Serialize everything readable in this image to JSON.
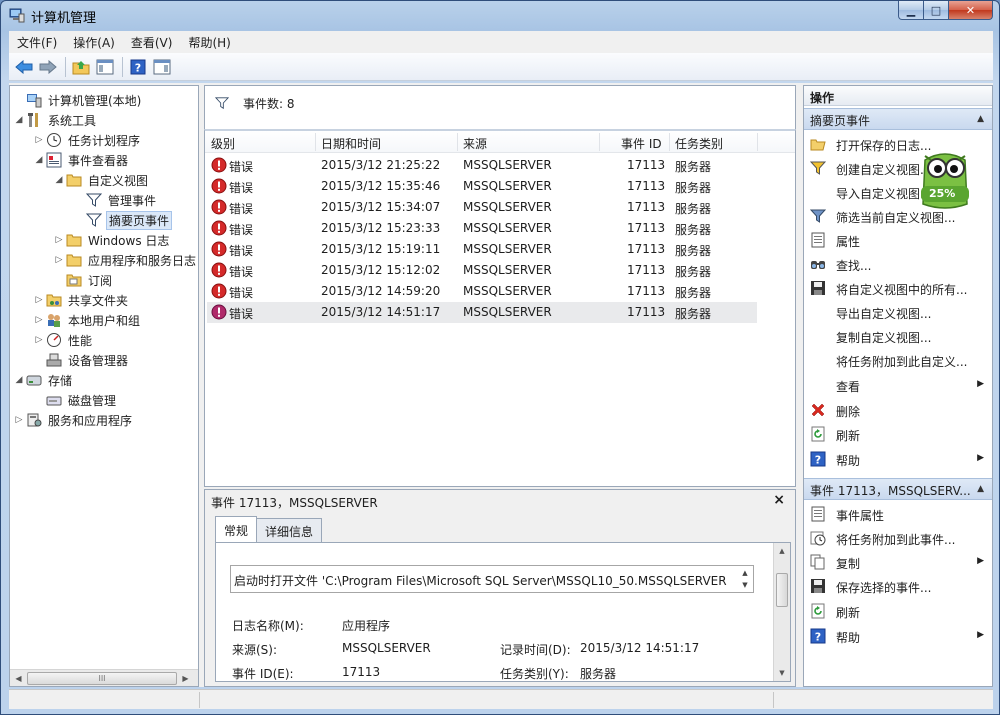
{
  "window": {
    "title": "计算机管理",
    "buttons": {
      "minimize": "▁",
      "maximize": "□",
      "close": "✕"
    }
  },
  "menu": [
    "文件(F)",
    "操作(A)",
    "查看(V)",
    "帮助(H)"
  ],
  "tree": {
    "items": [
      {
        "label": "计算机管理(本地)",
        "icon": "computer-icon"
      },
      {
        "label": "系统工具",
        "icon": "tools-icon"
      },
      {
        "label": "任务计划程序",
        "icon": "clock-icon"
      },
      {
        "label": "事件查看器",
        "icon": "event-viewer-icon"
      },
      {
        "label": "自定义视图",
        "icon": "folder-icon"
      },
      {
        "label": "管理事件",
        "icon": "filter-icon"
      },
      {
        "label": "摘要页事件",
        "icon": "filter-icon"
      },
      {
        "label": "Windows 日志",
        "icon": "folder-icon"
      },
      {
        "label": "应用程序和服务日志",
        "icon": "folder-icon"
      },
      {
        "label": "订阅",
        "icon": "subscription-icon"
      },
      {
        "label": "共享文件夹",
        "icon": "shared-folder-icon"
      },
      {
        "label": "本地用户和组",
        "icon": "users-icon"
      },
      {
        "label": "性能",
        "icon": "performance-icon"
      },
      {
        "label": "设备管理器",
        "icon": "device-manager-icon"
      },
      {
        "label": "存储",
        "icon": "storage-icon"
      },
      {
        "label": "磁盘管理",
        "icon": "disk-icon"
      },
      {
        "label": "服务和应用程序",
        "icon": "services-icon"
      }
    ],
    "scroll_grip": "III"
  },
  "events": {
    "count_label": "事件数: 8",
    "columns": [
      "级别",
      "日期和时间",
      "来源",
      "事件 ID",
      "任务类别"
    ],
    "rows": [
      {
        "level": "错误",
        "datetime": "2015/3/12 21:25:22",
        "source": "MSSQLSERVER",
        "event_id": "17113",
        "category": "服务器"
      },
      {
        "level": "错误",
        "datetime": "2015/3/12 15:35:46",
        "source": "MSSQLSERVER",
        "event_id": "17113",
        "category": "服务器"
      },
      {
        "level": "错误",
        "datetime": "2015/3/12 15:34:07",
        "source": "MSSQLSERVER",
        "event_id": "17113",
        "category": "服务器"
      },
      {
        "level": "错误",
        "datetime": "2015/3/12 15:23:33",
        "source": "MSSQLSERVER",
        "event_id": "17113",
        "category": "服务器"
      },
      {
        "level": "错误",
        "datetime": "2015/3/12 15:19:11",
        "source": "MSSQLSERVER",
        "event_id": "17113",
        "category": "服务器"
      },
      {
        "level": "错误",
        "datetime": "2015/3/12 15:12:02",
        "source": "MSSQLSERVER",
        "event_id": "17113",
        "category": "服务器"
      },
      {
        "level": "错误",
        "datetime": "2015/3/12 14:59:20",
        "source": "MSSQLSERVER",
        "event_id": "17113",
        "category": "服务器"
      },
      {
        "level": "错误",
        "datetime": "2015/3/12 14:51:17",
        "source": "MSSQLSERVER",
        "event_id": "17113",
        "category": "服务器"
      }
    ]
  },
  "details": {
    "title": "事件 17113，MSSQLSERVER",
    "close": "×",
    "tabs": [
      "常规",
      "详细信息"
    ],
    "description": "启动时打开文件 'C:\\Program Files\\Microsoft SQL Server\\MSSQL10_50.MSSQLSERVER",
    "fields": {
      "log_name_label": "日志名称(M):",
      "log_name": "应用程序",
      "source_label": "来源(S):",
      "source": "MSSQLSERVER",
      "logged_label": "记录时间(D):",
      "logged": "2015/3/12 14:51:17",
      "event_id_label": "事件 ID(E):",
      "event_id": "17113",
      "category_label": "任务类别(Y):",
      "category": "服务器"
    }
  },
  "actions": {
    "title": "操作",
    "section1": "摘要页事件",
    "items1": [
      {
        "label": "打开保存的日志...",
        "icon": "open-log-icon"
      },
      {
        "label": "创建自定义视图...",
        "icon": "create-filter-icon"
      },
      {
        "label": "导入自定义视图...",
        "icon": ""
      },
      {
        "label": "筛选当前自定义视图...",
        "icon": "filter-icon"
      },
      {
        "label": "属性",
        "icon": "properties-icon"
      },
      {
        "label": "查找...",
        "icon": "find-icon"
      },
      {
        "label": "将自定义视图中的所有...",
        "icon": "save-icon"
      },
      {
        "label": "导出自定义视图...",
        "icon": ""
      },
      {
        "label": "复制自定义视图...",
        "icon": ""
      },
      {
        "label": "将任务附加到此自定义...",
        "icon": ""
      },
      {
        "label": "查看",
        "icon": "",
        "submenu": true
      },
      {
        "label": "删除",
        "icon": "delete-icon"
      },
      {
        "label": "刷新",
        "icon": "refresh-icon"
      },
      {
        "label": "帮助",
        "icon": "help-icon",
        "submenu": true
      }
    ],
    "section2": "事件 17113，MSSQLSERV...",
    "items2": [
      {
        "label": "事件属性",
        "icon": "properties-icon"
      },
      {
        "label": "将任务附加到此事件...",
        "icon": "attach-task-icon"
      },
      {
        "label": "复制",
        "icon": "copy-icon",
        "submenu": true
      },
      {
        "label": "保存选择的事件...",
        "icon": "save-icon"
      },
      {
        "label": "刷新",
        "icon": "refresh-icon"
      },
      {
        "label": "帮助",
        "icon": "help-icon",
        "submenu": true
      }
    ]
  },
  "overlay": {
    "percent": "25%"
  }
}
